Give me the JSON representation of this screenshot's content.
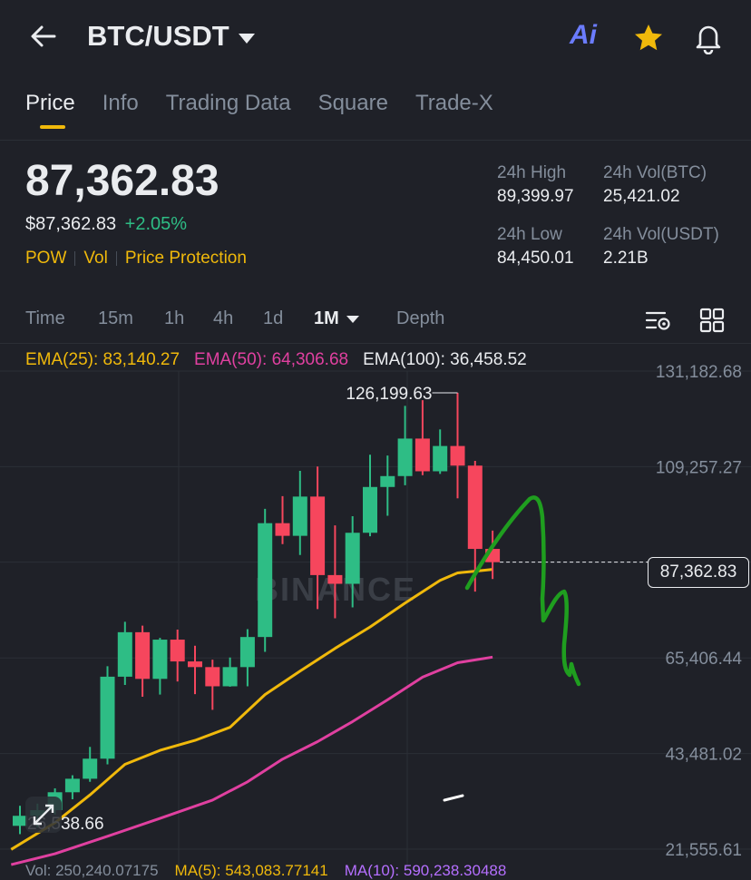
{
  "header": {
    "pair": "BTC/USDT",
    "ai_label": "Ai"
  },
  "tabs": [
    "Price",
    "Info",
    "Trading Data",
    "Square",
    "Trade-X"
  ],
  "price": {
    "last": "87,362.83",
    "fiat": "$87,362.83",
    "change": "+2.05%",
    "tags": [
      "POW",
      "Vol",
      "Price Protection"
    ]
  },
  "stats": {
    "high_label": "24h High",
    "high": "89,399.97",
    "vol_btc_label": "24h Vol(BTC)",
    "vol_btc": "25,421.02",
    "low_label": "24h Low",
    "low": "84,450.01",
    "vol_usdt_label": "24h Vol(USDT)",
    "vol_usdt": "2.21B"
  },
  "timeframes": [
    "Time",
    "15m",
    "1h",
    "4h",
    "1d",
    "1M",
    "Depth"
  ],
  "active_timeframe": "1M",
  "ema": {
    "ema25": "EMA(25): 83,140.27",
    "ema50": "EMA(50): 64,306.68",
    "ema100": "EMA(100): 36,458.52"
  },
  "colors": {
    "up": "#2ebd85",
    "down": "#f6465d",
    "ema25": "#f0b90b",
    "ema50": "#e040a0",
    "accent": "#f0b90b",
    "annotation": "#1f9e1f"
  },
  "watermark": "BINANCE",
  "volume_row": {
    "vol": "Vol: 250,240.07175",
    "ma5": "MA(5): 543,083.77141",
    "ma10": "MA(10): 590,238.30488"
  },
  "chart_data": {
    "type": "candlestick",
    "y_ticks": [
      "131,182.68",
      "109,257.27",
      "87,362.83",
      "65,406.44",
      "43,481.02",
      "21,555.61"
    ],
    "y_tick_values": [
      131182.68,
      109257.27,
      87362.83,
      65406.44,
      43481.02,
      21555.61
    ],
    "ylim": [
      21555.61,
      131182.68
    ],
    "current_price": 87362.83,
    "current_price_label": "87,362.83",
    "max_label": "126,199.63",
    "max_value": 126199.63,
    "min_label": "26,538.66",
    "min_value": 26538.66,
    "candles": [
      {
        "o": 26900,
        "h": 31500,
        "l": 25000,
        "c": 29200
      },
      {
        "o": 29200,
        "h": 32000,
        "l": 26538.66,
        "c": 30500
      },
      {
        "o": 30500,
        "h": 35500,
        "l": 29500,
        "c": 34600
      },
      {
        "o": 34600,
        "h": 38500,
        "l": 33000,
        "c": 37700
      },
      {
        "o": 37700,
        "h": 45000,
        "l": 37000,
        "c": 42300
      },
      {
        "o": 42300,
        "h": 63500,
        "l": 41000,
        "c": 61100
      },
      {
        "o": 61100,
        "h": 73700,
        "l": 59200,
        "c": 71300
      },
      {
        "o": 71300,
        "h": 72800,
        "l": 56500,
        "c": 60600
      },
      {
        "o": 60600,
        "h": 70000,
        "l": 57000,
        "c": 69600
      },
      {
        "o": 69600,
        "h": 71900,
        "l": 60000,
        "c": 64600
      },
      {
        "o": 64600,
        "h": 68200,
        "l": 57100,
        "c": 63300
      },
      {
        "o": 63300,
        "h": 65000,
        "l": 53500,
        "c": 58900
      },
      {
        "o": 58900,
        "h": 65500,
        "l": 58800,
        "c": 63300
      },
      {
        "o": 63300,
        "h": 72000,
        "l": 58900,
        "c": 70200
      },
      {
        "o": 70200,
        "h": 99600,
        "l": 66800,
        "c": 96300
      },
      {
        "o": 96300,
        "h": 102500,
        "l": 91500,
        "c": 93400
      },
      {
        "o": 93400,
        "h": 108300,
        "l": 89000,
        "c": 102400
      },
      {
        "o": 102400,
        "h": 109300,
        "l": 76600,
        "c": 84400
      },
      {
        "o": 84400,
        "h": 95800,
        "l": 74500,
        "c": 82400
      },
      {
        "o": 82400,
        "h": 97900,
        "l": 77000,
        "c": 94100
      },
      {
        "o": 94100,
        "h": 112000,
        "l": 93300,
        "c": 104600
      },
      {
        "o": 104600,
        "h": 111800,
        "l": 98000,
        "c": 107100
      },
      {
        "o": 107100,
        "h": 123200,
        "l": 105000,
        "c": 115700
      },
      {
        "o": 115700,
        "h": 124500,
        "l": 107300,
        "c": 108200
      },
      {
        "o": 108200,
        "h": 117800,
        "l": 107600,
        "c": 114000
      },
      {
        "o": 114000,
        "h": 126199.63,
        "l": 102000,
        "c": 109500
      },
      {
        "o": 109500,
        "h": 110600,
        "l": 80600,
        "c": 90400
      },
      {
        "o": 90400,
        "h": 94600,
        "l": 83500,
        "c": 87362.83
      }
    ],
    "ema25": [
      {
        "i": -0.5,
        "v": 21500
      },
      {
        "i": 2,
        "v": 27600
      },
      {
        "i": 4,
        "v": 34000
      },
      {
        "i": 6,
        "v": 41000
      },
      {
        "i": 8,
        "v": 44200
      },
      {
        "i": 10,
        "v": 46500
      },
      {
        "i": 12,
        "v": 49500
      },
      {
        "i": 14,
        "v": 57000
      },
      {
        "i": 16,
        "v": 62400
      },
      {
        "i": 18,
        "v": 67600
      },
      {
        "i": 20,
        "v": 72500
      },
      {
        "i": 22,
        "v": 78000
      },
      {
        "i": 24,
        "v": 83200
      },
      {
        "i": 25,
        "v": 84900
      },
      {
        "i": 26,
        "v": 85300
      },
      {
        "i": 27,
        "v": 85700
      }
    ],
    "ema50": [
      {
        "i": -0.5,
        "v": 18000
      },
      {
        "i": 2,
        "v": 20500
      },
      {
        "i": 5,
        "v": 24500
      },
      {
        "i": 8,
        "v": 28600
      },
      {
        "i": 11,
        "v": 32800
      },
      {
        "i": 13,
        "v": 37000
      },
      {
        "i": 15,
        "v": 42200
      },
      {
        "i": 17,
        "v": 46200
      },
      {
        "i": 19,
        "v": 50800
      },
      {
        "i": 21,
        "v": 55800
      },
      {
        "i": 23,
        "v": 61000
      },
      {
        "i": 25,
        "v": 64300
      },
      {
        "i": 27,
        "v": 65600
      }
    ]
  }
}
